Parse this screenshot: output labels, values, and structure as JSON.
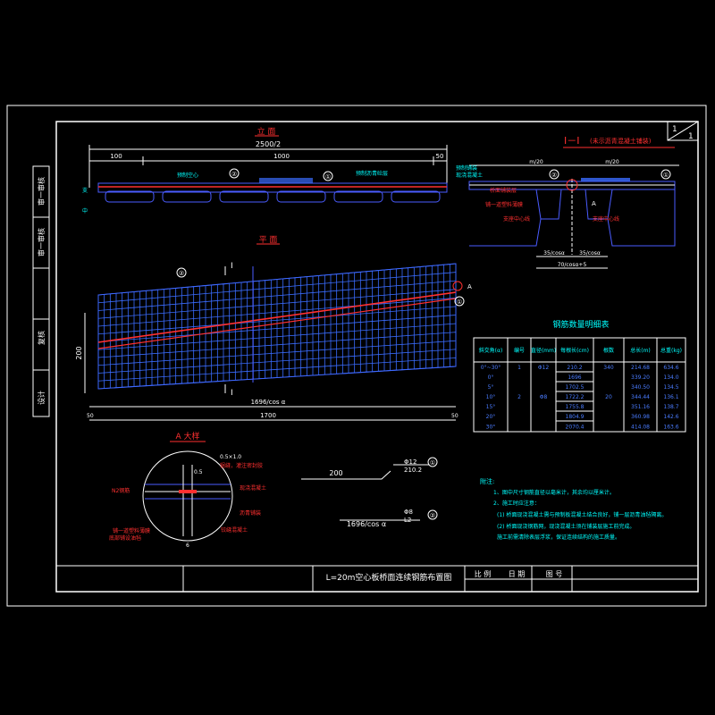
{
  "colors": {
    "background": "#000000",
    "frame": "#ffffff",
    "outline": "#4a5cff",
    "rebar": "#3a6cff",
    "highlight": "#ff3030",
    "label": "#00ffff",
    "annotation": "#ffff00"
  },
  "sheet": {
    "number": "1",
    "total": "1"
  },
  "side_block": {
    "items": [
      "审一审核",
      "审一审核",
      "复核",
      "设计"
    ]
  },
  "title_block": {
    "drawing_title": "L=20m空心板桥面连续钢筋布置图",
    "scale_label": "比 例",
    "date_label": "日 期",
    "drawing_no_label": "图 号"
  },
  "elevation": {
    "title": "立 面",
    "dim_total": "2500/2",
    "dim_left": "100",
    "dim_mid": "1000",
    "dim_right": "50",
    "callout_1": "①",
    "callout_2": "②",
    "left_note": "预制空心",
    "right_note": "预制沥青砼层"
  },
  "plan": {
    "title": "平 面",
    "section_mark": "I",
    "dim_height": "200",
    "dim_left": "50",
    "dim_right": "50",
    "dim_length_upper": "1696/cos α",
    "dim_length_lower": "1700",
    "callout_1": "①",
    "callout_2": "②",
    "callout_a": "A"
  },
  "section": {
    "title": "I－I",
    "subtitle": "(未示沥青混凝土铺装)",
    "label_top_left": "预制铺装",
    "label_mid_left": "现浇混凝土",
    "label_red_1": "桥面铺装层",
    "label_red_2": "铺一道塑料薄膜",
    "label_left_box": "支座中心线",
    "label_right_box": "支座中心线",
    "dim_a": "m/20",
    "dim_b": "m/20",
    "dim_c": "35/cosα",
    "dim_d": "35/cosα",
    "dim_e": "70/cosα+5",
    "callout_1": "①",
    "callout_2": "②",
    "callout_a": "A"
  },
  "detail": {
    "title": "A 大样",
    "note_top": "0.5×1.0",
    "note_gap": "0.5",
    "note_red_1": "锯缝，灌注密封胶",
    "note_red_2": "现浇混凝土",
    "note_red_3": "沥青铺装",
    "note_red_4": "N2钢筋",
    "note_red_5": "铰缝混凝土",
    "note_red_6": "铺一道塑料薄膜",
    "note_red_7": "底部铺设油毡",
    "dim_bottom": "6"
  },
  "rebar_1": {
    "length_label": "200",
    "spec": "Φ12",
    "length": "210.2",
    "callout": "①"
  },
  "rebar_2": {
    "length_label": "1696/cos α",
    "spec": "Φ8",
    "length": "L2",
    "callout": "②"
  },
  "table": {
    "title": "钢筋数量明细表",
    "headers": [
      "斜交角(α)",
      "编号",
      "直径(mm)",
      "每根长(cm)",
      "根数",
      "总长(m)",
      "总重(kg)"
    ],
    "rows": [
      [
        "0°~30°",
        "1",
        "Φ12",
        "210.2",
        "340",
        "214.68",
        "634.6"
      ],
      [
        "0°",
        "",
        "",
        "1696",
        "",
        "339.20",
        "134.0"
      ],
      [
        "5°",
        "",
        "",
        "1702.5",
        "",
        "340.50",
        "134.5"
      ],
      [
        "10°",
        "2",
        "Φ8",
        "1722.2",
        "20",
        "344.44",
        "136.1"
      ],
      [
        "15°",
        "",
        "",
        "1755.8",
        "",
        "351.16",
        "138.7"
      ],
      [
        "20°",
        "",
        "",
        "1804.9",
        "",
        "360.98",
        "142.6"
      ],
      [
        "30°",
        "",
        "",
        "2070.4",
        "",
        "414.08",
        "163.6"
      ]
    ]
  },
  "notes": {
    "heading": "附注:",
    "lines": [
      "1、图中尺寸钢筋直径以毫米计，其余均以厘米计。",
      "2、施工时应注意：",
      "(1) 桥面现浇混凝土需与预制板混凝土结合良好，铺一层沥青油毡隔离。",
      "(2) 桥面现浇钢筋网，现浇混凝土须在铺装层施工前完成。",
      "     施工前需清除表层浮浆，保证连续结构的施工质量。"
    ]
  }
}
